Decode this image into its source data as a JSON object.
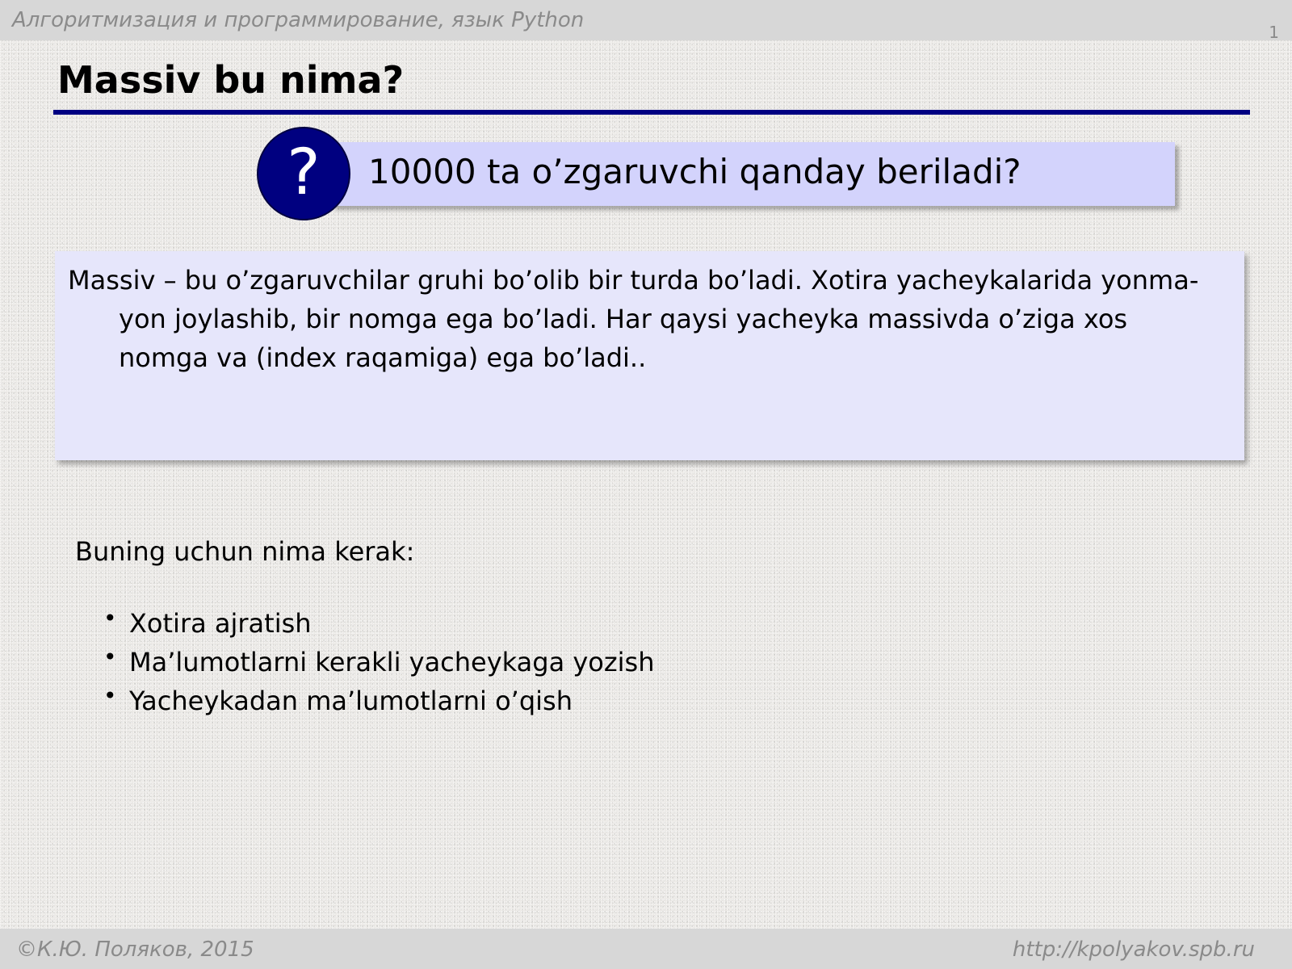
{
  "header": {
    "course_title": "Алгоритмизация и программирование, язык Python",
    "page_number": "1"
  },
  "slide": {
    "title": "Massiv bu nima?"
  },
  "question": {
    "icon": "?",
    "text": "10000 ta o’zgaruvchi qanday beriladi?"
  },
  "definition": {
    "text": "Massiv – bu o’zgaruvchilar gruhi bo’olib bir turda bo’ladi. Xotira yacheykalarida yonma-yon joylashib, bir nomga ega bo’ladi. Har qaysi yacheyka massivda o’ziga xos nomga va (index raqamiga) ega bo’ladi.."
  },
  "needs": {
    "intro": "Buning uchun nima kerak:",
    "bullet": "•",
    "items": [
      "Xotira ajratish",
      "Ma’lumotlarni kerakli yacheykaga yozish",
      "Yacheykadan ma’lumotlarni o’qish"
    ]
  },
  "footer": {
    "left": "©К.Ю. Поляков, 2015",
    "right": "http://kpolyakov.spb.ru"
  },
  "colors": {
    "title_rule": "#000082",
    "question_circle": "#000080",
    "question_box": "#d3d3fc",
    "definition_box": "#e6e6fb",
    "bars": "#d7d7d7"
  }
}
